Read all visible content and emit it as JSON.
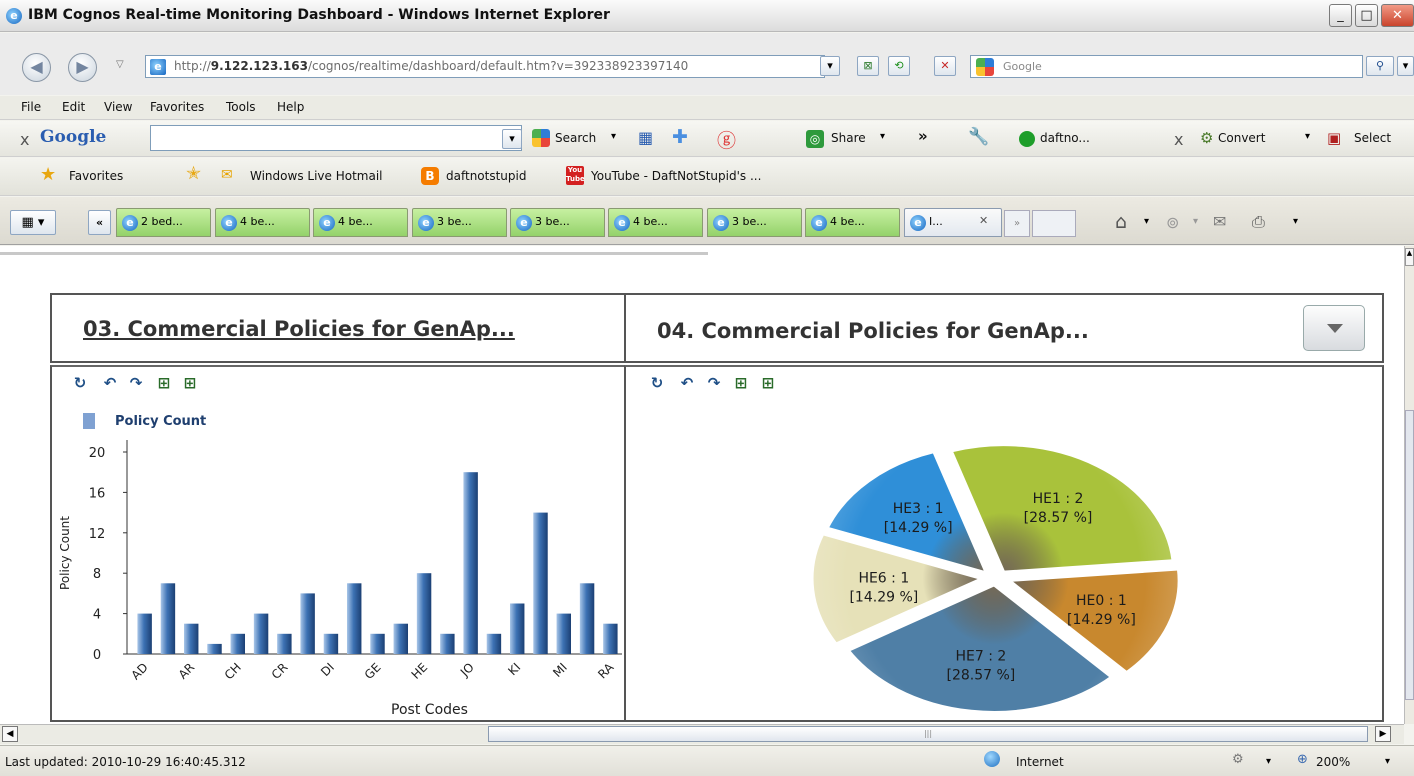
{
  "window": {
    "title": "IBM Cognos Real-time Monitoring Dashboard - Windows Internet Explorer",
    "address_prefix": "http://",
    "address_host": "9.122.123.163",
    "address_path": "/cognos/realtime/dashboard/default.htm?v=392338923397140",
    "search_placeholder": "Google"
  },
  "menu": [
    "File",
    "Edit",
    "View",
    "Favorites",
    "Tools",
    "Help"
  ],
  "google_toolbar": {
    "logo": "Google",
    "search_label": "Search",
    "share_label": "Share",
    "user_label": "daftno...",
    "convert_label": "Convert",
    "select_label": "Select",
    "close_glyph": "x",
    "more_glyph": "»"
  },
  "favorites": {
    "label": "Favorites",
    "links": [
      "Windows Live Hotmail",
      "daftnotstupid",
      "YouTube - DaftNotStupid's ..."
    ]
  },
  "tabs": [
    {
      "label": "2 bed..."
    },
    {
      "label": "4 be..."
    },
    {
      "label": "4 be..."
    },
    {
      "label": "3 be..."
    },
    {
      "label": "3 be..."
    },
    {
      "label": "4 be..."
    },
    {
      "label": "3 be..."
    },
    {
      "label": "4 be..."
    },
    {
      "label": "I..."
    }
  ],
  "panels": {
    "left_title": "03. Commercial Policies for GenAp...",
    "right_title": "04. Commercial Policies for GenAp..."
  },
  "chart_data": [
    {
      "type": "bar",
      "legend": "Policy Count",
      "ylabel": "Policy Count",
      "xlabel": "Post Codes",
      "ylim": [
        0,
        20
      ],
      "yticks": [
        0,
        4,
        8,
        12,
        16,
        20
      ],
      "categories": [
        "AD",
        "",
        "AR",
        "",
        "CH",
        "",
        "CR",
        "",
        "DI",
        "",
        "GE",
        "",
        "HE",
        "",
        "JO",
        "",
        "KI",
        "",
        "MI",
        "",
        "RA"
      ],
      "values": [
        4,
        7,
        3,
        1,
        2,
        4,
        2,
        6,
        2,
        7,
        2,
        3,
        8,
        2,
        18,
        2,
        5,
        14,
        4,
        7,
        3
      ],
      "bar_color": "#3d72b4"
    },
    {
      "type": "pie",
      "slices": [
        {
          "label": "HE1 : 2",
          "pct": "[28.57 %]",
          "value": 2,
          "color": "#a9c23b"
        },
        {
          "label": "HE0 : 1",
          "pct": "[14.29 %]",
          "value": 1,
          "color": "#c8882e"
        },
        {
          "label": "HE7 : 2",
          "pct": "[28.57 %]",
          "value": 2,
          "color": "#4f7fa6"
        },
        {
          "label": "HE6 : 1",
          "pct": "[14.29 %]",
          "value": 1,
          "color": "#e6e1b8"
        },
        {
          "label": "HE3 : 1",
          "pct": "[14.29 %]",
          "value": 1,
          "color": "#2f8fd8"
        }
      ]
    }
  ],
  "status": {
    "updated": "Last updated: 2010-10-29 16:40:45.312",
    "zone": "Internet",
    "zoom": "200%"
  }
}
